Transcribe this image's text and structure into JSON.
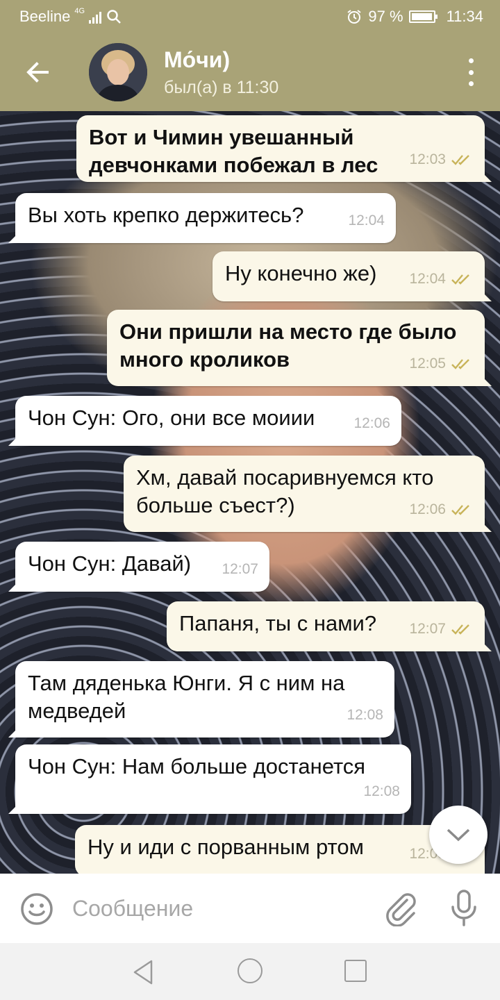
{
  "status_bar": {
    "carrier": "Beeline",
    "network": "4G",
    "alarm_icon": "alarm-icon",
    "battery": "97 %",
    "battery_level": 0.97,
    "time": "11:34"
  },
  "header": {
    "back_icon": "arrow-left-icon",
    "title": "Мо́чи)",
    "subtitle": "был(а) в 11:30",
    "menu_icon": "more-vertical-icon"
  },
  "colors": {
    "header_bg": "#a9a377",
    "outgoing_bubble": "#fbf7e8",
    "incoming_bubble": "#ffffff",
    "check_color": "#c8b45a"
  },
  "messages": [
    {
      "direction": "out",
      "bold": true,
      "text": "Вот и Чимин увешанный девчонками побежал в лес",
      "time": "12:03",
      "read": true
    },
    {
      "direction": "in",
      "bold": false,
      "text": "Вы хоть крепко держитесь?",
      "time": "12:04"
    },
    {
      "direction": "out",
      "bold": false,
      "text": "Ну конечно же)",
      "time": "12:04",
      "read": true
    },
    {
      "direction": "out",
      "bold": true,
      "text": "Они пришли на место где было много кроликов",
      "time": "12:05",
      "read": true
    },
    {
      "direction": "in",
      "bold": false,
      "text": "Чон Сун: Ого, они все моиии",
      "time": "12:06"
    },
    {
      "direction": "out",
      "bold": false,
      "text": "Хм, давай посаривнуемся кто больше съест?)",
      "time": "12:06",
      "read": true
    },
    {
      "direction": "in",
      "bold": false,
      "text": "Чон Сун: Давай)",
      "time": "12:07"
    },
    {
      "direction": "out",
      "bold": false,
      "text": "Папаня, ты с нами?",
      "time": "12:07",
      "read": true
    },
    {
      "direction": "in",
      "bold": false,
      "text": "Там дяденька Юнги. Я с ним на медведей",
      "time": "12:08"
    },
    {
      "direction": "in",
      "bold": false,
      "text": "Чон Сун: Нам больше достанется",
      "time": "12:08"
    },
    {
      "direction": "out",
      "bold": false,
      "text": "Ну и иди с порванным ртом",
      "time": "12:08",
      "read": true
    }
  ],
  "composer": {
    "placeholder": "Сообщение",
    "emoji_icon": "emoji-icon",
    "attach_icon": "paperclip-icon",
    "mic_icon": "microphone-icon"
  },
  "navigation": {
    "back_icon": "nav-back-icon",
    "home_icon": "nav-home-icon",
    "recents_icon": "nav-recents-icon"
  }
}
